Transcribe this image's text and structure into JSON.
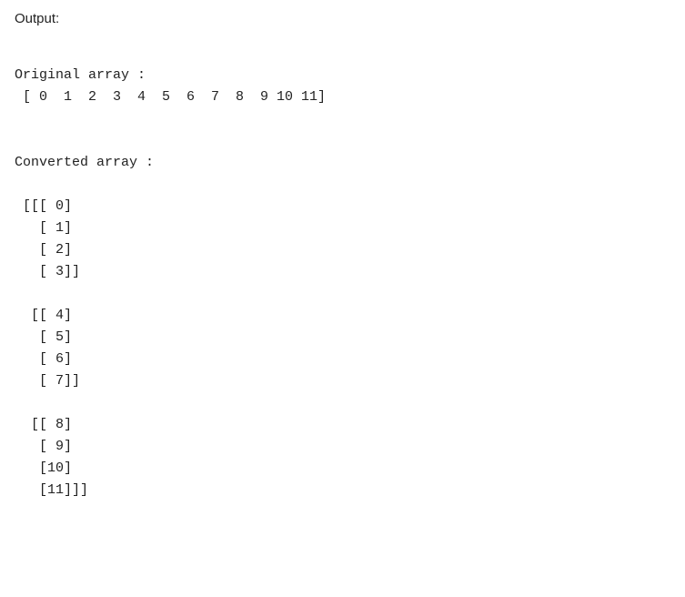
{
  "output_label": "Output:",
  "original_label": "Original array :",
  "original_array": " [ 0  1  2  3  4  5  6  7  8  9 10 11]",
  "converted_label": "Converted array :",
  "converted_array": " [[[ 0]\n   [ 1]\n   [ 2]\n   [ 3]]\n\n  [[ 4]\n   [ 5]\n   [ 6]\n   [ 7]]\n\n  [[ 8]\n   [ 9]\n   [10]\n   [11]]]"
}
